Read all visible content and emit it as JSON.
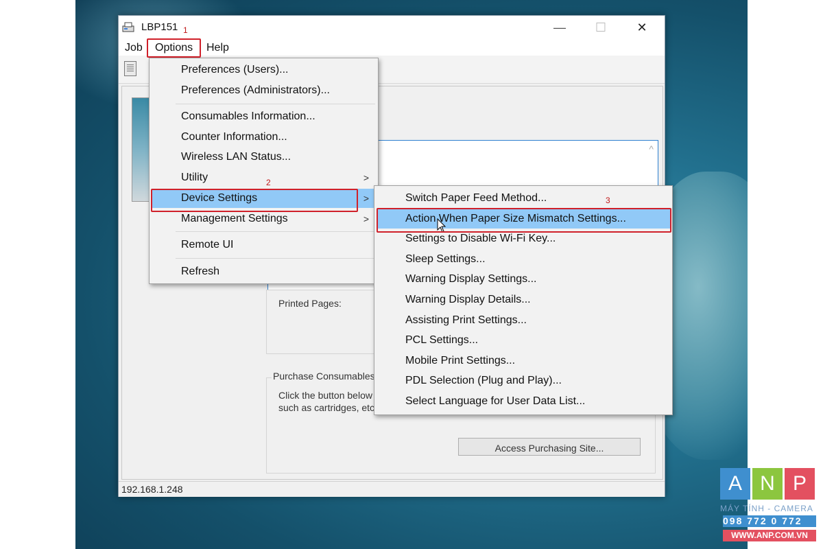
{
  "window": {
    "title": "LBP151",
    "controls": {
      "minimize": "—",
      "maximize": "☐",
      "close": "✕"
    }
  },
  "menubar": {
    "items": [
      "Job",
      "Options",
      "Help"
    ]
  },
  "options_menu": {
    "items": [
      "Preferences (Users)...",
      "Preferences (Administrators)...",
      "Consumables Information...",
      "Counter Information...",
      "Wireless LAN Status...",
      "Utility",
      "Device Settings",
      "Management Settings",
      "Remote UI",
      "Refresh"
    ],
    "highlighted": "Device Settings"
  },
  "device_settings_submenu": {
    "items": [
      "Switch Paper Feed Method...",
      "Action When Paper Size Mismatch Settings...",
      "Settings to Disable Wi-Fi Key...",
      "Sleep Settings...",
      "Warning Display Settings...",
      "Warning Display Details...",
      "Assisting Print Settings...",
      "PCL Settings...",
      "Mobile Print Settings...",
      "PDL Selection (Plug and Play)...",
      "Select Language for User Data List..."
    ],
    "highlighted": "Action When Paper Size Mismatch Settings..."
  },
  "content": {
    "printed_pages_label": "Printed Pages:",
    "purchase_consumables_legend": "Purchase Consumables",
    "purchase_desc_line1": "Click the button below",
    "purchase_desc_line2": "such as cartridges, etc",
    "access_button": "Access Purchasing Site..."
  },
  "status_bar": {
    "ip": "192.168.1.248"
  },
  "annotations": {
    "step1": "1",
    "step2": "2",
    "step3": "3"
  },
  "watermark": {
    "letters": [
      "A",
      "N",
      "P"
    ],
    "line1": "MÁY TÍNH - CAMERA",
    "line2": "098 772 0 772",
    "line3": "WWW.ANP.COM.VN"
  },
  "colors": {
    "highlight": "#91c9f7",
    "annotation_red": "#d0202a",
    "logo_blue": "#3f8fcf",
    "logo_green": "#8cc63f",
    "logo_red": "#e35060"
  }
}
